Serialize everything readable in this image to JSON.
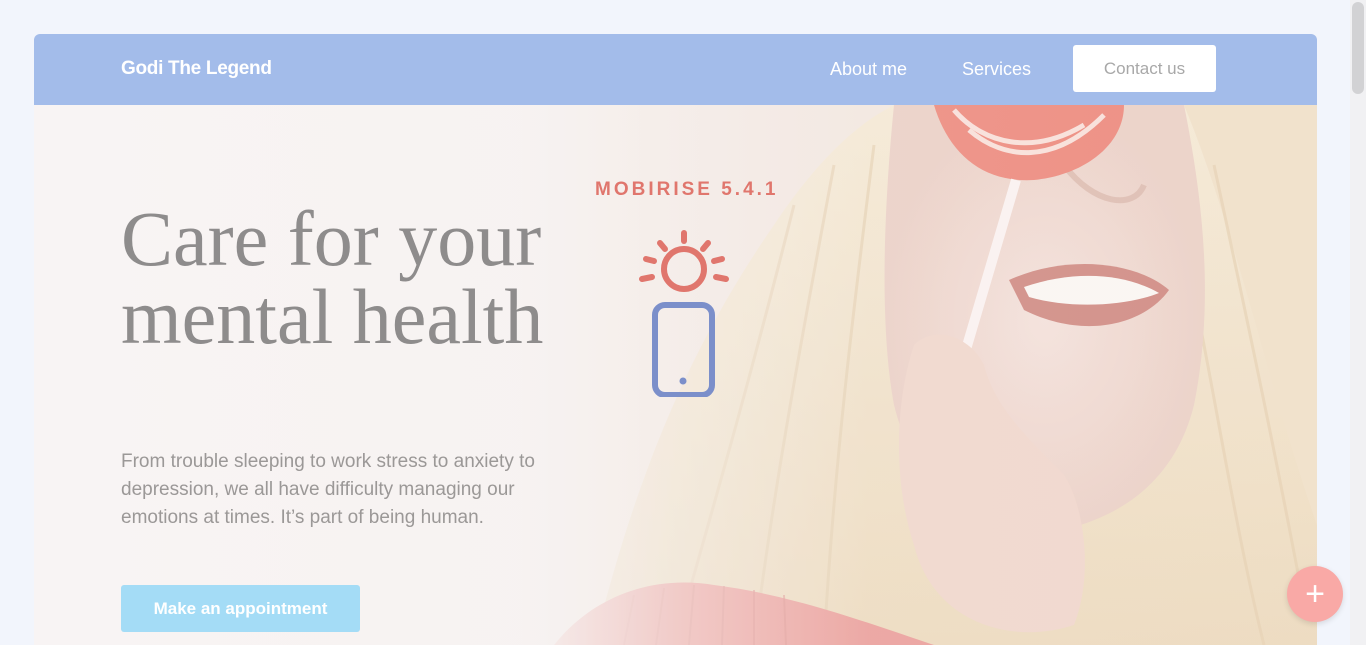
{
  "navbar": {
    "brand": "Godi The Legend",
    "links": [
      "About me",
      "Services"
    ],
    "contact_label": "Contact us"
  },
  "hero": {
    "headline": "Care for your mental health",
    "subtext": "From trouble sleeping to work stress to anxiety to depression, we all have difficulty managing our emotions at times. It’s part of being human.",
    "cta_label": "Make an appointment"
  },
  "badge": {
    "text": "MOBIRISE  5.4.1"
  },
  "fab": {
    "label": "+"
  },
  "colors": {
    "navbar": "#a3bcea",
    "cta": "#a4dcf6",
    "fab": "#f9a9a6",
    "accent_red": "#e0766d",
    "accent_blue": "#7b8fca"
  },
  "icons": [
    "sun-icon",
    "smartphone-icon",
    "plus-icon"
  ]
}
